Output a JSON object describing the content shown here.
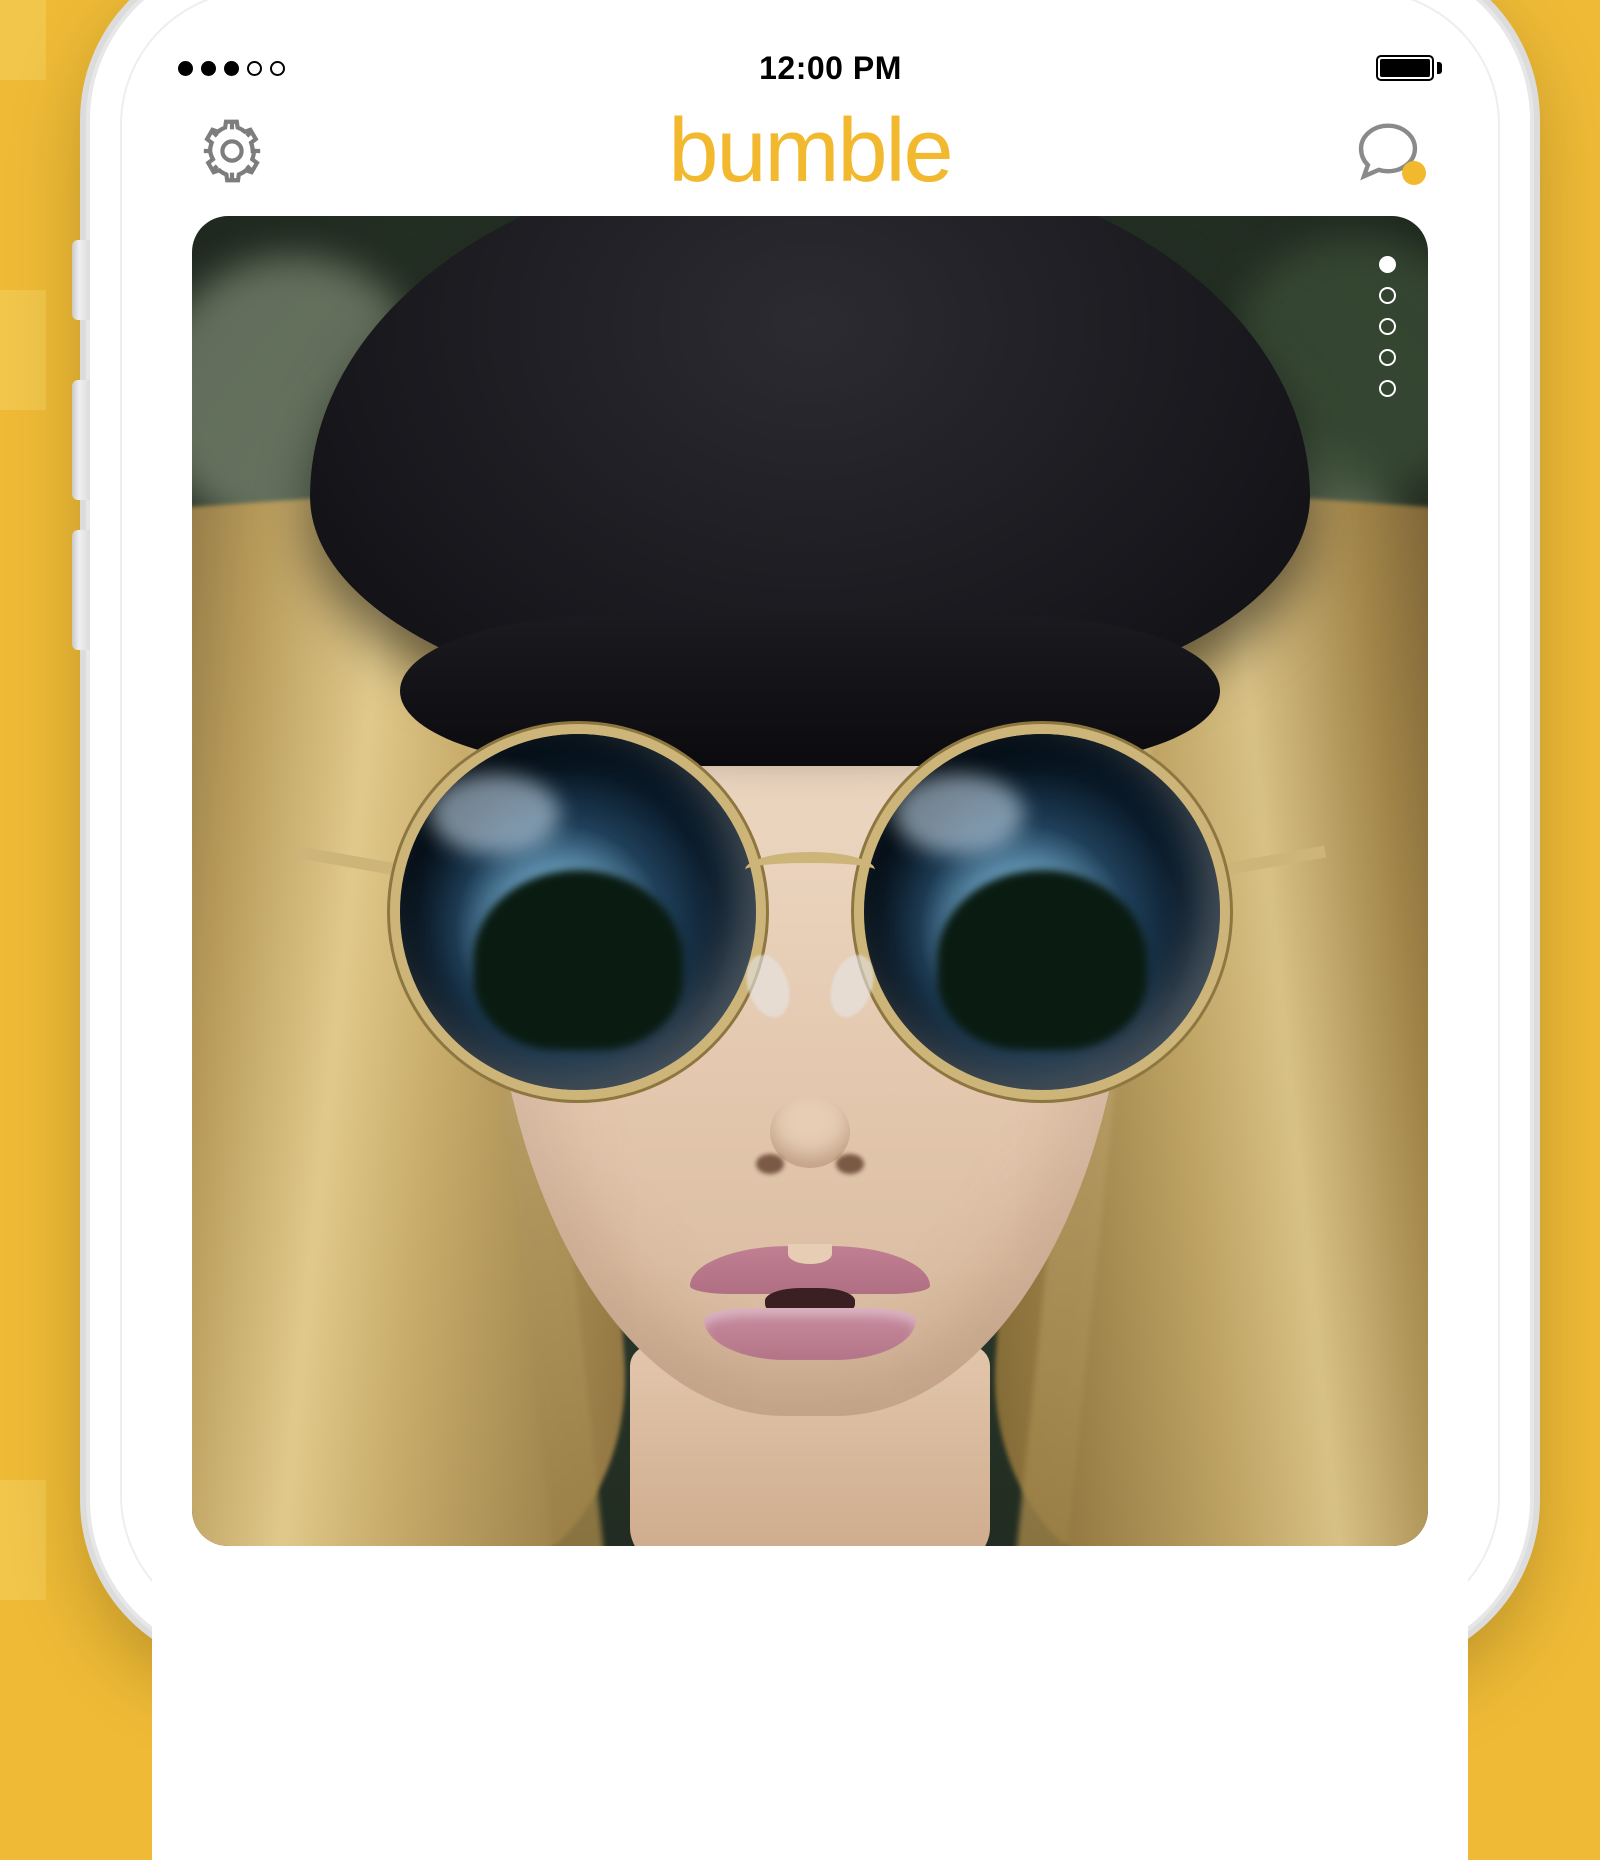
{
  "status_bar": {
    "time": "12:00 PM",
    "signal_filled": 3,
    "signal_total": 5
  },
  "header": {
    "app_name": "bumble",
    "brand_color": "#f2b92f",
    "settings_icon": "gear-icon",
    "chat_icon": "chat-bubble-icon",
    "chat_has_notification": true
  },
  "profile_card": {
    "photo_description": "Person with long blonde hair wearing a black beret and round reflective sunglasses",
    "photo_count": 5,
    "current_photo_index": 0
  }
}
